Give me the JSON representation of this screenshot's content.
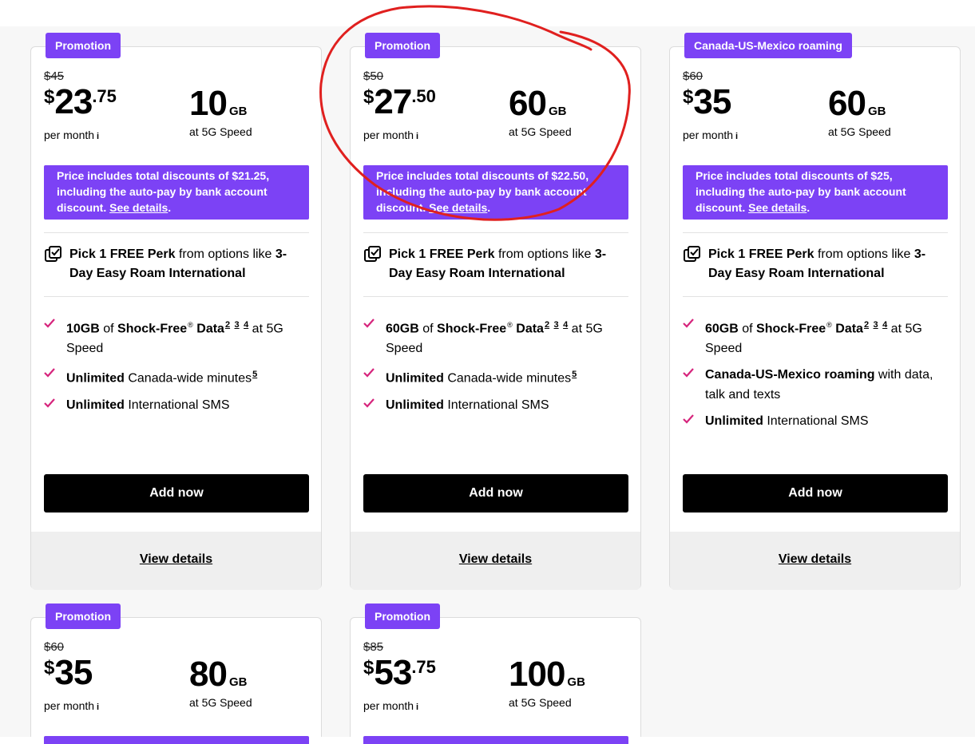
{
  "cards": [
    {
      "badge": "Promotion",
      "old_price": "$45",
      "currency": "$",
      "dollars": "23",
      "cents": ".75",
      "per_month": "per month",
      "info": "i",
      "data_num": "10",
      "data_unit": "GB",
      "speed": "at 5G Speed",
      "discount_text": "Price includes total discounts of $21.25, including the auto-pay by bank account discount.",
      "discount_link": "See details",
      "discount_end": ".",
      "perk": {
        "b1": "Pick 1 FREE Perk",
        "t1": " from options like ",
        "b2": "3-Day Easy Roam International"
      },
      "features": [
        {
          "b": "10GB",
          "t1": " of ",
          "b2": "Shock-Free",
          "reg": "®",
          "b3": " Data",
          "refs": [
            "2",
            "3",
            "4"
          ],
          "t2": " at 5G Speed"
        },
        {
          "b": "Unlimited",
          "t1": " Canada-wide minutes",
          "refs": [
            "5"
          ]
        },
        {
          "b": "Unlimited",
          "t1": " International SMS"
        }
      ],
      "add_label": "Add now",
      "details_label": "View details"
    },
    {
      "badge": "Promotion",
      "old_price": "$50",
      "currency": "$",
      "dollars": "27",
      "cents": ".50",
      "per_month": "per month",
      "info": "i",
      "data_num": "60",
      "data_unit": "GB",
      "speed": "at 5G Speed",
      "discount_text": "Price includes total discounts of $22.50, including the auto-pay by bank account discount.",
      "discount_link": "See details",
      "discount_end": ".",
      "perk": {
        "b1": "Pick 1 FREE Perk",
        "t1": " from options like ",
        "b2": "3-Day Easy Roam International"
      },
      "features": [
        {
          "b": "60GB",
          "t1": " of ",
          "b2": "Shock-Free",
          "reg": "®",
          "b3": " Data",
          "refs": [
            "2",
            "3",
            "4"
          ],
          "t2": " at 5G Speed"
        },
        {
          "b": "Unlimited",
          "t1": " Canada-wide minutes",
          "refs": [
            "5"
          ]
        },
        {
          "b": "Unlimited",
          "t1": " International SMS"
        }
      ],
      "add_label": "Add now",
      "details_label": "View details"
    },
    {
      "badge": "Canada-US-Mexico roaming",
      "old_price": "$60",
      "currency": "$",
      "dollars": "35",
      "cents": "",
      "per_month": "per month",
      "info": "i",
      "data_num": "60",
      "data_unit": "GB",
      "speed": "at 5G Speed",
      "discount_text": "Price includes total discounts of $25, including the auto-pay by bank account discount.",
      "discount_link": "See details",
      "discount_end": ".",
      "perk": {
        "b1": "Pick 1 FREE Perk",
        "t1": " from options like ",
        "b2": "3-Day Easy Roam International"
      },
      "features": [
        {
          "b": "60GB",
          "t1": " of ",
          "b2": "Shock-Free",
          "reg": "®",
          "b3": " Data",
          "refs": [
            "2",
            "3",
            "4"
          ],
          "t2": " at 5G Speed"
        },
        {
          "b": "Canada-US-Mexico roaming",
          "t1": " with data, talk and texts"
        },
        {
          "b": "Unlimited",
          "t1": " International SMS"
        }
      ],
      "add_label": "Add now",
      "details_label": "View details"
    },
    {
      "badge": "Promotion",
      "old_price": "$60",
      "currency": "$",
      "dollars": "35",
      "cents": "",
      "per_month": "per month",
      "info": "i",
      "data_num": "80",
      "data_unit": "GB",
      "speed": "at 5G Speed"
    },
    {
      "badge": "Promotion",
      "old_price": "$85",
      "currency": "$",
      "dollars": "53",
      "cents": ".75",
      "per_month": "per month",
      "info": "i",
      "data_num": "100",
      "data_unit": "GB",
      "speed": "at 5G Speed"
    }
  ],
  "colors": {
    "accent": "#7c42f5",
    "check": "#d6247c",
    "annotation": "#e0201f",
    "button": "#000000"
  },
  "icons": {
    "perk": "checkbox-check-icon",
    "feature": "checkmark-icon",
    "info": "info-icon"
  }
}
